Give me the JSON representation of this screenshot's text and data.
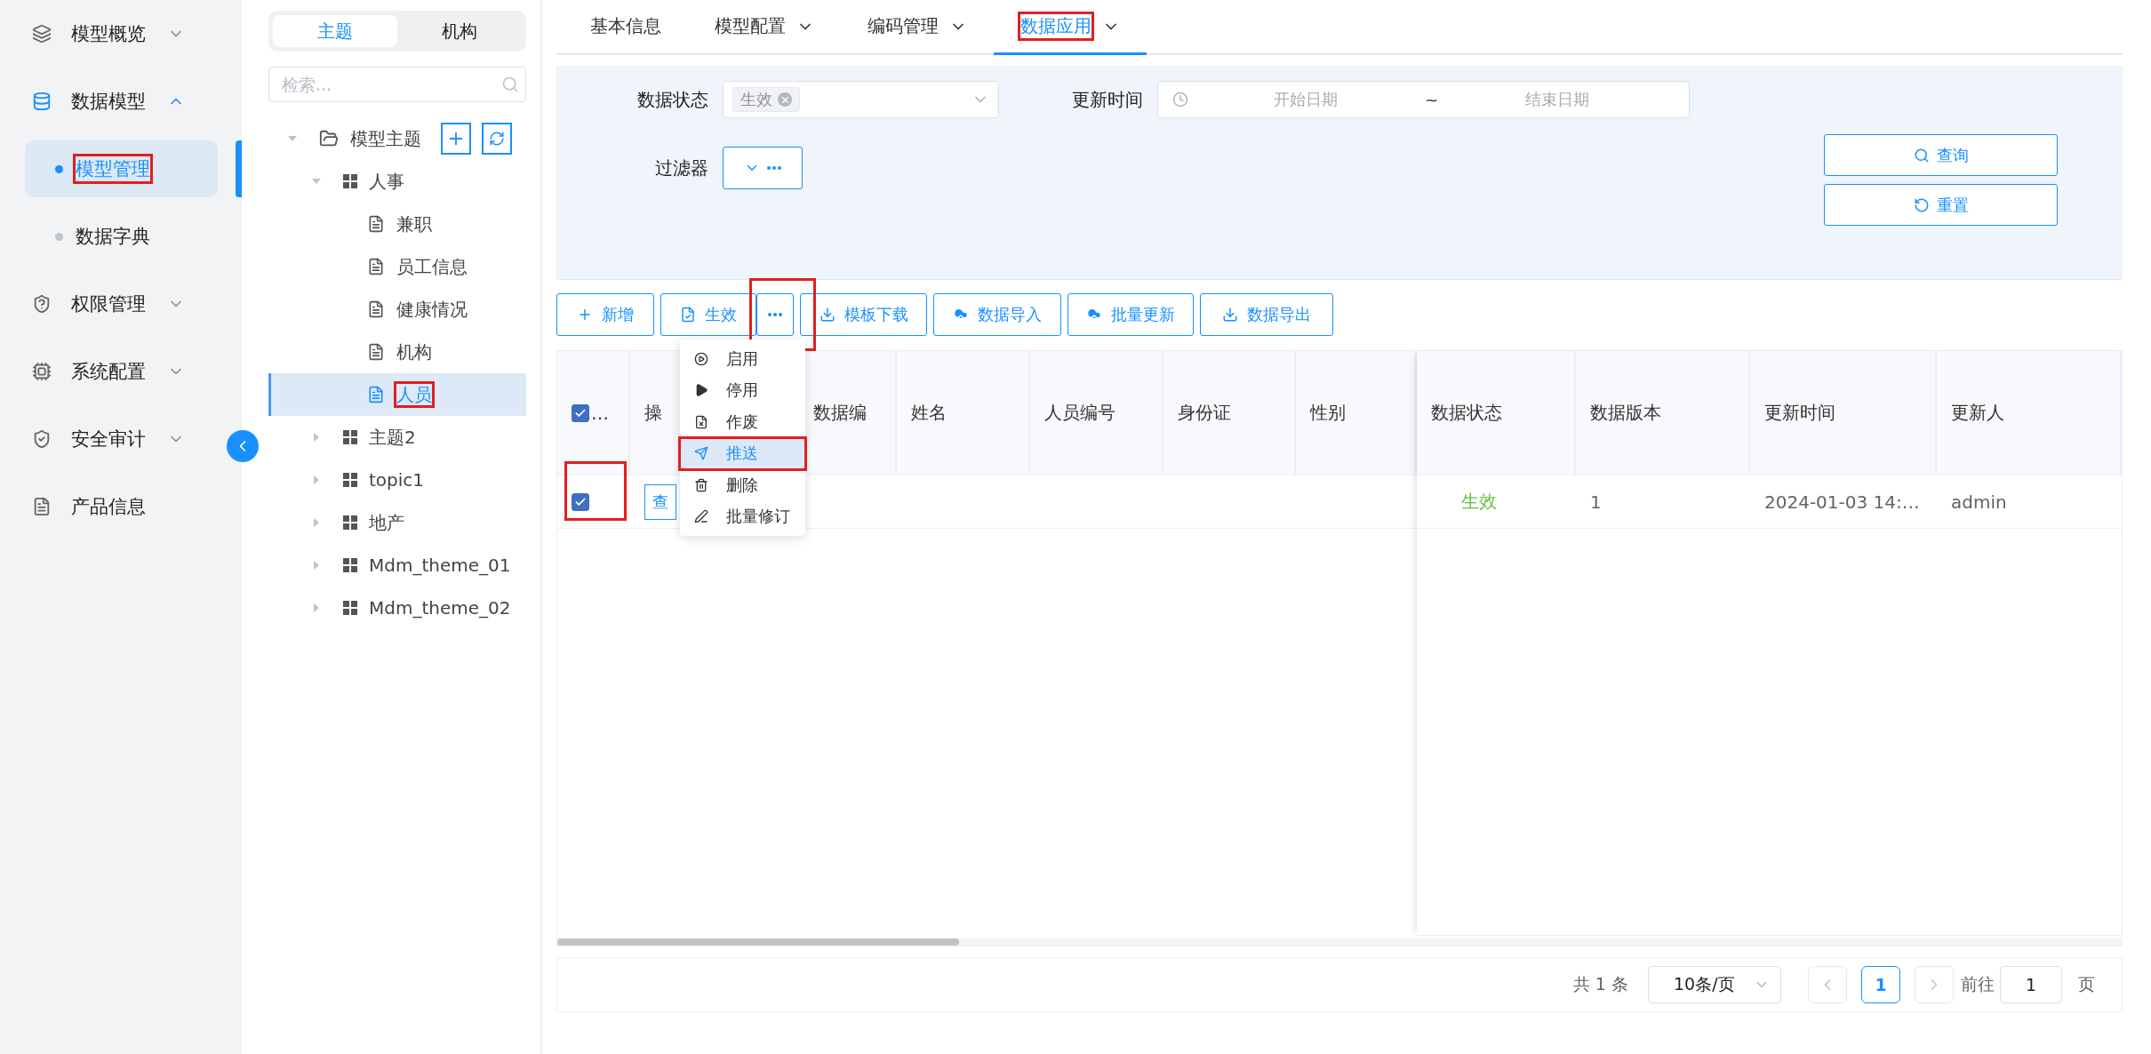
{
  "nav": {
    "items": [
      {
        "label": "模型概览",
        "kind": "group",
        "expanded": false
      },
      {
        "label": "数据模型",
        "kind": "group",
        "expanded": true,
        "children": [
          {
            "label": "模型管理",
            "selected": true,
            "annotated": true
          },
          {
            "label": "数据字典",
            "selected": false,
            "annotated": false
          }
        ]
      },
      {
        "label": "权限管理",
        "kind": "group",
        "expanded": false
      },
      {
        "label": "系统配置",
        "kind": "group",
        "expanded": false
      },
      {
        "label": "安全审计",
        "kind": "group",
        "expanded": false
      },
      {
        "label": "产品信息",
        "kind": "link"
      }
    ]
  },
  "tree_panel": {
    "tabs": [
      {
        "label": "主题",
        "selected": true
      },
      {
        "label": "机构",
        "selected": false
      }
    ],
    "search": {
      "placeholder": "检索..."
    },
    "tree": [
      {
        "label": "模型主题",
        "kind": "root",
        "expanded": true,
        "children": [
          {
            "label": "人事",
            "kind": "group",
            "expanded": true,
            "children": [
              {
                "label": "兼职",
                "kind": "table",
                "selected": false,
                "annotated": false
              },
              {
                "label": "员工信息",
                "kind": "table",
                "selected": false,
                "annotated": false
              },
              {
                "label": "健康情况",
                "kind": "table",
                "selected": false,
                "annotated": false
              },
              {
                "label": "机构",
                "kind": "table",
                "selected": false,
                "annotated": false
              },
              {
                "label": "人员",
                "kind": "table",
                "selected": true,
                "annotated": true
              }
            ]
          },
          {
            "label": "主题2",
            "kind": "group",
            "expanded": false
          },
          {
            "label": "topic1",
            "kind": "group",
            "expanded": false
          },
          {
            "label": "地产",
            "kind": "group",
            "expanded": false
          },
          {
            "label": "Mdm_theme_01",
            "kind": "group",
            "expanded": false
          },
          {
            "label": "Mdm_theme_02",
            "kind": "group",
            "expanded": false
          }
        ]
      }
    ]
  },
  "tabs": [
    {
      "label": "基本信息",
      "has_menu": false,
      "selected": false,
      "annotated": false
    },
    {
      "label": "模型配置",
      "has_menu": true,
      "selected": false,
      "annotated": false
    },
    {
      "label": "编码管理",
      "has_menu": true,
      "selected": false,
      "annotated": false
    },
    {
      "label": "数据应用",
      "has_menu": true,
      "selected": true,
      "annotated": true
    }
  ],
  "filters": {
    "status": {
      "label": "数据状态",
      "tags": [
        "生效"
      ]
    },
    "update_time": {
      "label": "更新时间",
      "start_placeholder": "开始日期",
      "separator": "~",
      "end_placeholder": "结束日期"
    },
    "filter": {
      "label": "过滤器"
    },
    "buttons": [
      {
        "label": "查询"
      },
      {
        "label": "重置"
      }
    ]
  },
  "toolbar": [
    {
      "kind": "button",
      "label": "新增"
    },
    {
      "kind": "button",
      "label": "生效"
    },
    {
      "kind": "more",
      "annotated": true
    },
    {
      "kind": "button",
      "label": "模板下载"
    },
    {
      "kind": "button",
      "label": "数据导入"
    },
    {
      "kind": "button",
      "label": "批量更新"
    },
    {
      "kind": "button",
      "label": "数据导出"
    }
  ],
  "action_menu": [
    {
      "label": "启用",
      "selected": false,
      "annotated": false
    },
    {
      "label": "停用",
      "selected": false,
      "annotated": false
    },
    {
      "label": "作废",
      "selected": false,
      "annotated": false
    },
    {
      "label": "推送",
      "selected": true,
      "annotated": true
    },
    {
      "label": "删除",
      "selected": false,
      "annotated": false
    },
    {
      "label": "批量修订",
      "selected": false,
      "annotated": false
    }
  ],
  "table": {
    "select_all": {
      "checked": true,
      "label": "…"
    },
    "columns": [
      "操",
      "数据编",
      "姓名",
      "人员编号",
      "身份证",
      "性别"
    ],
    "pinned_columns": [
      "数据状态",
      "数据版本",
      "更新时间",
      "更新人"
    ],
    "rows": [
      {
        "checked": true,
        "annotated": true,
        "action": "查",
        "pinned_cells": [
          {
            "kind": "status",
            "text": "生效"
          },
          {
            "kind": "text",
            "text": "1"
          },
          {
            "kind": "text",
            "text": "2024-01-03 14:…"
          },
          {
            "kind": "text",
            "text": "admin"
          }
        ]
      }
    ]
  },
  "pagination": {
    "total": "共 1 条",
    "page_size": "10条/页",
    "pages": [
      {
        "label": "1",
        "selected": true
      }
    ],
    "goto_label": "前往",
    "goto_value": "1",
    "page_suffix": "页"
  }
}
